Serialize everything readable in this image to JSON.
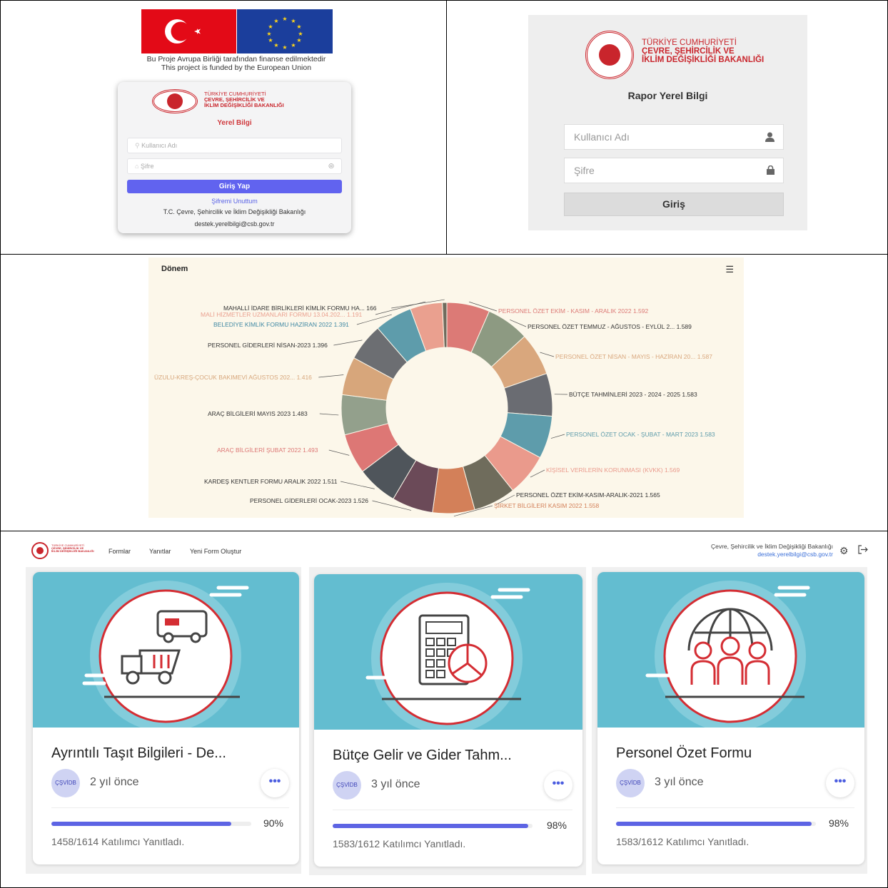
{
  "eu_panel": {
    "note_tr": "Bu Proje Avrupa Birliği tarafından finanse edilmektedir",
    "note_en": "This project is funded by the European Union"
  },
  "ministry": {
    "line1": "TÜRKİYE CUMHURİYETİ",
    "line2": "ÇEVRE, ŞEHİRCİLİK VE",
    "line3": "İKLİM DEĞİŞİKLİĞİ BAKANLIĞI"
  },
  "login1": {
    "app_title": "Yerel Bilgi",
    "username_placeholder": "Kullanıcı Adı",
    "password_placeholder": "Şifre",
    "submit_label": "Giriş Yap",
    "forgot_label": "Şifremi Unuttum",
    "footer_org": "T.C. Çevre, Şehircilik ve İklim Değişikliği Bakanlığı",
    "footer_email": "destek.yerelbilgi@csb.gov.tr"
  },
  "login2": {
    "app_title": "Rapor Yerel Bilgi",
    "username_placeholder": "Kullanıcı Adı",
    "password_placeholder": "Şifre",
    "submit_label": "Giriş"
  },
  "chart": {
    "title": "Dönem",
    "menu_icon": "hamburger-icon"
  },
  "chart_data": {
    "type": "pie",
    "title": "Dönem",
    "donut": true,
    "slices": [
      {
        "label": "PERSONEL ÖZET EKİM - KASIM - ARALIK 2022",
        "value": 1592,
        "value_text": "1.592",
        "color": "#dc7a76"
      },
      {
        "label": "PERSONEL ÖZET TEMMUZ - AĞUSTOS - EYLÜL 2...",
        "value": 1589,
        "value_text": "1.589",
        "color": "#8d9a82"
      },
      {
        "label": "PERSONEL ÖZET NİSAN - MAYIS - HAZİRAN 20...",
        "value": 1587,
        "value_text": "1.587",
        "color": "#d9a77d"
      },
      {
        "label": "BÜTÇE TAHMİNLERİ 2023 - 2024 - 2025",
        "value": 1583,
        "value_text": "1.583",
        "color": "#6a6c72"
      },
      {
        "label": "PERSONEL ÖZET OCAK - ŞUBAT - MART 2023",
        "value": 1583,
        "value_text": "1.583",
        "color": "#5e9cab"
      },
      {
        "label": "KİŞİSEL VERİLERİN KORUNMASI (KVKK)",
        "value": 1569,
        "value_text": "1.569",
        "color": "#ea9a8c"
      },
      {
        "label": "PERSONEL ÖZET EKİM-KASIM-ARALIK-2021",
        "value": 1565,
        "value_text": "1.565",
        "color": "#6f6c5c"
      },
      {
        "label": "ŞİRKET BİLGİLERİ KASIM 2022",
        "value": 1558,
        "value_text": "1.558",
        "color": "#d38059"
      },
      {
        "label": "PERSONEL GİDERLERİ OCAK-2023",
        "value": 1526,
        "value_text": "1.526",
        "color": "#6b4a58"
      },
      {
        "label": "KARDEŞ KENTLER FORMU ARALIK 2022",
        "value": 1511,
        "value_text": "1.511",
        "color": "#4f555b"
      },
      {
        "label": "ARAÇ BİLGİLERİ ŞUBAT 2022",
        "value": 1493,
        "value_text": "1.493",
        "color": "#dd7775"
      },
      {
        "label": "ARAÇ BİLGİLERİ MAYIS 2023",
        "value": 1483,
        "value_text": "1.483",
        "color": "#93a08c"
      },
      {
        "label": "ÜZULU-KREŞ-ÇOCUK BAKIMEVİ AĞUSTOS 202...",
        "value": 1416,
        "value_text": "1.416",
        "color": "#d7a67b"
      },
      {
        "label": "PERSONEL GİDERLERİ NİSAN-2023",
        "value": 1396,
        "value_text": "1.396",
        "color": "#6c6e72"
      },
      {
        "label": "BELEDİYE KİMLİK FORMU HAZİRAN 2022",
        "value": 1391,
        "value_text": "1.391",
        "color": "#5e9cab"
      },
      {
        "label": "MALİ HİZMETLER UZMANLARI FORMU 13.04.202...",
        "value": 1191,
        "value_text": "1.191",
        "color": "#eaa08f"
      },
      {
        "label": "MAHALLİ İDARE BİRLİKLERİ KİMLİK FORMU HA...",
        "value": 166,
        "value_text": "166",
        "color": "#706c5e"
      }
    ]
  },
  "dashboard": {
    "nav": [
      "Formlar",
      "Yanıtlar",
      "Yeni Form Oluştur"
    ],
    "org_name": "Çevre, Şehircilik ve İklim Değişikliği Bakanlığı",
    "email": "destek.yerelbilgi@csb.gov.tr",
    "settings_icon": "gear-icon",
    "logout_icon": "logout-icon",
    "cards": [
      {
        "title": "Ayrıntılı Taşıt Bilgileri - De...",
        "badge": "ÇŞVİDB",
        "ago": "2 yıl önce",
        "progress": 90,
        "pct_text": "90%",
        "responses": "1458/1614 Katılımcı Yanıtladı.",
        "icon": "vehicles-icon"
      },
      {
        "title": "Bütçe Gelir ve Gider Tahm...",
        "badge": "ÇŞVİDB",
        "ago": "3 yıl önce",
        "progress": 98,
        "pct_text": "98%",
        "responses": "1583/1612 Katılımcı Yanıtladı.",
        "icon": "calculator-icon"
      },
      {
        "title": "Personel Özet Formu",
        "badge": "ÇŞVİDB",
        "ago": "3 yıl önce",
        "progress": 98,
        "pct_text": "98%",
        "responses": "1583/1612 Katılımcı Yanıtladı.",
        "icon": "people-globe-icon"
      }
    ]
  }
}
